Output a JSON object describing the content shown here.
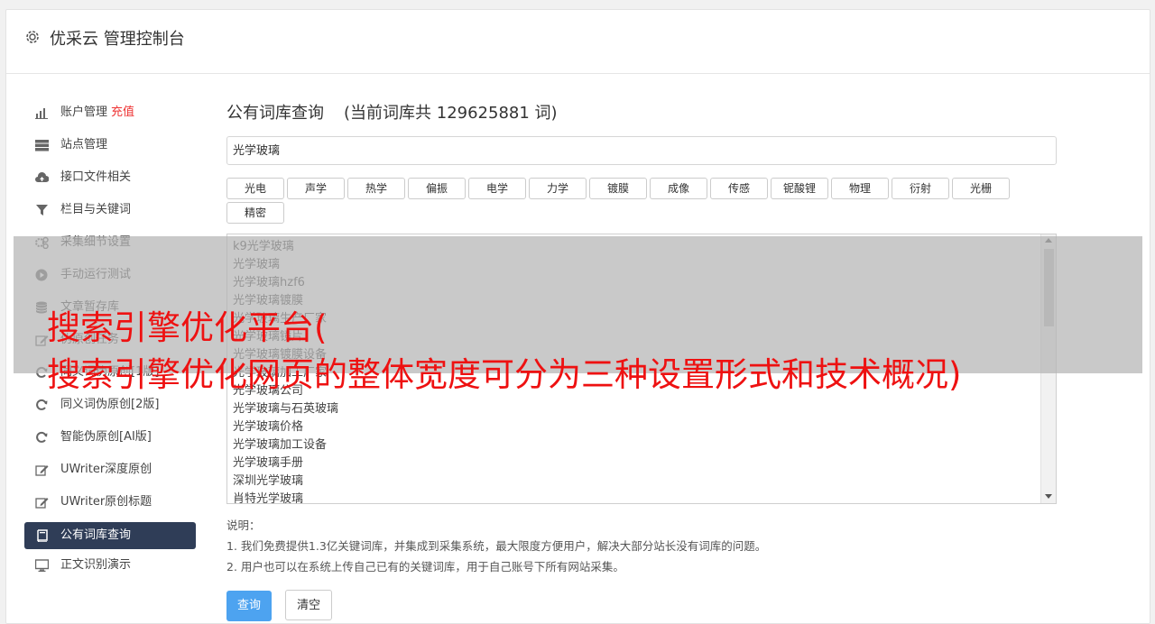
{
  "header": {
    "title": "优采云 管理控制台"
  },
  "sidebar": {
    "items": [
      {
        "label": "账户管理",
        "badge": "充值",
        "icon": "bar-chart-icon"
      },
      {
        "label": "站点管理",
        "icon": "server-icon"
      },
      {
        "label": "接口文件相关",
        "icon": "cloud-upload-icon"
      },
      {
        "label": "栏目与关键词",
        "icon": "filter-icon"
      },
      {
        "label": "采集细节设置",
        "icon": "gears-icon"
      },
      {
        "label": "手动运行测试",
        "icon": "play-icon"
      },
      {
        "label": "文章暂存库",
        "icon": "database-icon"
      },
      {
        "label": "伪原创任务",
        "icon": "edit-icon"
      },
      {
        "label": "同义词伪原创[1版]",
        "icon": "refresh-icon"
      },
      {
        "label": "同义词伪原创[2版]",
        "icon": "refresh-icon"
      },
      {
        "label": "智能伪原创[AI版]",
        "icon": "refresh-icon"
      },
      {
        "label": "UWriter深度原创",
        "icon": "edit-icon"
      },
      {
        "label": "UWriter原创标题",
        "icon": "edit-icon"
      },
      {
        "label": "公有词库查询",
        "icon": "book-icon",
        "active": true
      },
      {
        "label": "正文识别演示",
        "icon": "monitor-icon"
      }
    ]
  },
  "main": {
    "title": "公有词库查询",
    "count_text": "(当前词库共 129625881 词)",
    "search_value": "光学玻璃",
    "tags": [
      "光电",
      "声学",
      "热学",
      "偏振",
      "电学",
      "力学",
      "镀膜",
      "成像",
      "传感",
      "铌酸锂",
      "物理",
      "衍射",
      "光栅",
      "精密"
    ],
    "results": [
      "k9光学玻璃",
      "光学玻璃",
      "光学玻璃hzf6",
      "光学玻璃镀膜",
      "光学玻璃生产厂家",
      "光学玻璃镜片",
      "光学玻璃镀膜设备",
      "光学玻璃加工厂家",
      "光学玻璃公司",
      "光学玻璃与石英玻璃",
      "光学玻璃价格",
      "光学玻璃加工设备",
      "光学玻璃手册",
      "深圳光学玻璃",
      "肖特光学玻璃"
    ],
    "notes_title": "说明：",
    "notes": [
      "1. 我们免费提供1.3亿关键词库，并集成到采集系统，最大限度方便用户，解决大部分站长没有词库的问题。",
      "2. 用户也可以在系统上传自己已有的关键词库，用于自己账号下所有网站采集。"
    ],
    "query_button": "查询",
    "clear_button": "清空"
  },
  "overlay": {
    "line1": "搜索引擎优化平台(",
    "line2": "搜索引擎优化网页的整体宽度可分为三种设置形式和技术概况)"
  },
  "colors": {
    "accent": "#4da3f0",
    "sidebar_active": "#2f3d57",
    "badge": "#ee3333",
    "overlay_text": "#ee1111"
  }
}
